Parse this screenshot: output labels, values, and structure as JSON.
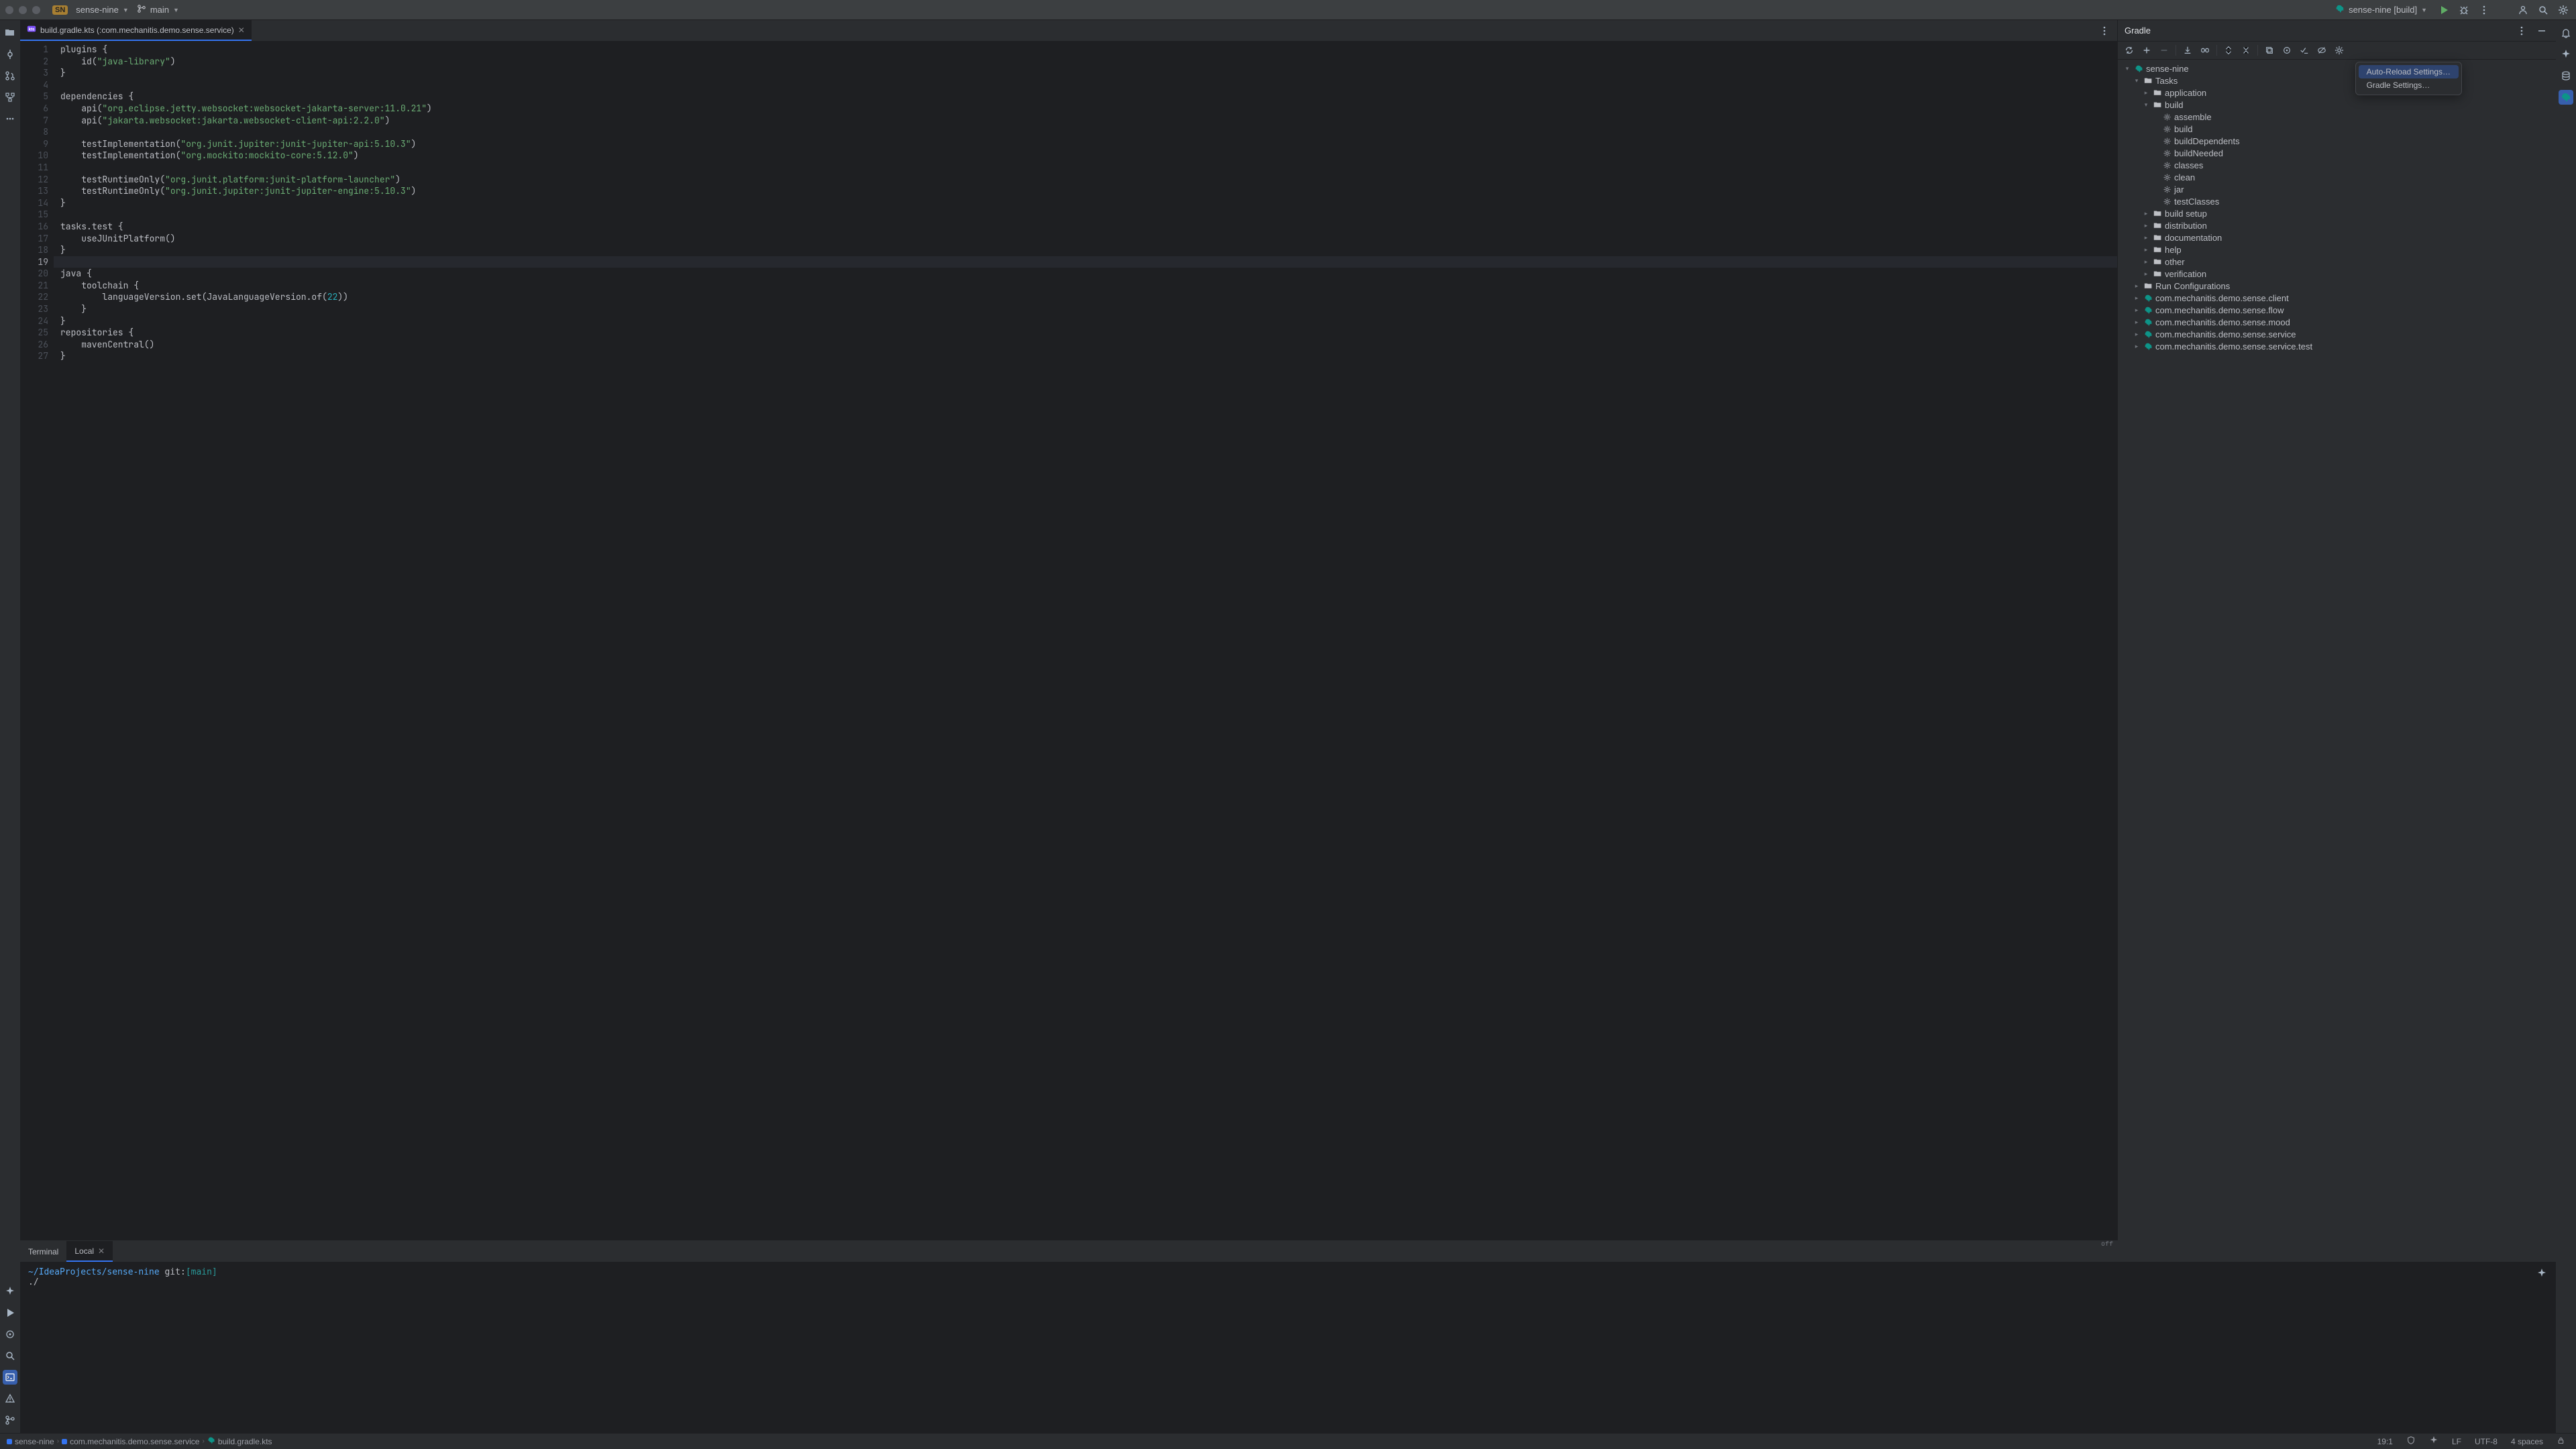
{
  "topbar": {
    "project_badge": "SN",
    "project_name": "sense-nine",
    "branch": "main",
    "run_config": "sense-nine [build]"
  },
  "editor": {
    "tab_label": "build.gradle.kts (:com.mechanitis.demo.sense.service)",
    "off_label": "off",
    "lines": [
      {
        "n": 1,
        "seg": [
          {
            "t": "plugins {",
            "c": ""
          }
        ]
      },
      {
        "n": 2,
        "seg": [
          {
            "t": "    id(",
            "c": ""
          },
          {
            "t": "\"java-library\"",
            "c": "str"
          },
          {
            "t": ")",
            "c": ""
          }
        ]
      },
      {
        "n": 3,
        "seg": [
          {
            "t": "}",
            "c": ""
          }
        ]
      },
      {
        "n": 4,
        "seg": [
          {
            "t": "",
            "c": ""
          }
        ]
      },
      {
        "n": 5,
        "seg": [
          {
            "t": "dependencies {",
            "c": ""
          }
        ]
      },
      {
        "n": 6,
        "seg": [
          {
            "t": "    api(",
            "c": ""
          },
          {
            "t": "\"org.eclipse.jetty.websocket:websocket-jakarta-server:11.0.21\"",
            "c": "str"
          },
          {
            "t": ")",
            "c": ""
          }
        ]
      },
      {
        "n": 7,
        "seg": [
          {
            "t": "    api(",
            "c": ""
          },
          {
            "t": "\"jakarta.websocket:jakarta.websocket-client-api:2.2.0\"",
            "c": "str"
          },
          {
            "t": ")",
            "c": ""
          }
        ]
      },
      {
        "n": 8,
        "seg": [
          {
            "t": "",
            "c": ""
          }
        ]
      },
      {
        "n": 9,
        "seg": [
          {
            "t": "    testImplementation(",
            "c": ""
          },
          {
            "t": "\"org.junit.jupiter:junit-jupiter-api:5.10.3\"",
            "c": "str"
          },
          {
            "t": ")",
            "c": ""
          }
        ]
      },
      {
        "n": 10,
        "seg": [
          {
            "t": "    testImplementation(",
            "c": ""
          },
          {
            "t": "\"org.mockito:mockito-core:5.12.0\"",
            "c": "str"
          },
          {
            "t": ")",
            "c": ""
          }
        ]
      },
      {
        "n": 11,
        "seg": [
          {
            "t": "",
            "c": ""
          }
        ]
      },
      {
        "n": 12,
        "seg": [
          {
            "t": "    testRuntimeOnly(",
            "c": ""
          },
          {
            "t": "\"org.junit.platform:junit-platform-launcher\"",
            "c": "str"
          },
          {
            "t": ")",
            "c": ""
          }
        ]
      },
      {
        "n": 13,
        "seg": [
          {
            "t": "    testRuntimeOnly(",
            "c": ""
          },
          {
            "t": "\"org.junit.jupiter:junit-jupiter-engine:5.10.3\"",
            "c": "str"
          },
          {
            "t": ")",
            "c": ""
          }
        ]
      },
      {
        "n": 14,
        "seg": [
          {
            "t": "}",
            "c": ""
          }
        ]
      },
      {
        "n": 15,
        "seg": [
          {
            "t": "",
            "c": ""
          }
        ]
      },
      {
        "n": 16,
        "seg": [
          {
            "t": "tasks.test {",
            "c": ""
          }
        ]
      },
      {
        "n": 17,
        "seg": [
          {
            "t": "    useJUnitPlatform()",
            "c": ""
          }
        ]
      },
      {
        "n": 18,
        "seg": [
          {
            "t": "}",
            "c": ""
          }
        ]
      },
      {
        "n": 19,
        "seg": [
          {
            "t": "",
            "c": ""
          }
        ],
        "current": true
      },
      {
        "n": 20,
        "seg": [
          {
            "t": "java {",
            "c": ""
          }
        ]
      },
      {
        "n": 21,
        "seg": [
          {
            "t": "    toolchain {",
            "c": ""
          }
        ]
      },
      {
        "n": 22,
        "seg": [
          {
            "t": "        languageVersion.set(JavaLanguageVersion.of(",
            "c": ""
          },
          {
            "t": "22",
            "c": "num"
          },
          {
            "t": "))",
            "c": ""
          }
        ]
      },
      {
        "n": 23,
        "seg": [
          {
            "t": "    }",
            "c": ""
          }
        ]
      },
      {
        "n": 24,
        "seg": [
          {
            "t": "}",
            "c": ""
          }
        ]
      },
      {
        "n": 25,
        "seg": [
          {
            "t": "repositories {",
            "c": ""
          }
        ]
      },
      {
        "n": 26,
        "seg": [
          {
            "t": "    mavenCentral()",
            "c": ""
          }
        ]
      },
      {
        "n": 27,
        "seg": [
          {
            "t": "}",
            "c": ""
          }
        ]
      }
    ]
  },
  "gradle": {
    "title": "Gradle",
    "popup": {
      "auto_reload": "Auto-Reload Settings…",
      "gradle_settings": "Gradle Settings…"
    },
    "tree": [
      {
        "depth": 0,
        "arrow": "open",
        "icon": "elephant",
        "label": "sense-nine"
      },
      {
        "depth": 1,
        "arrow": "open",
        "icon": "folder",
        "label": "Tasks"
      },
      {
        "depth": 2,
        "arrow": "closed",
        "icon": "folder",
        "label": "application"
      },
      {
        "depth": 2,
        "arrow": "open",
        "icon": "folder",
        "label": "build"
      },
      {
        "depth": 3,
        "arrow": "none",
        "icon": "gear",
        "label": "assemble"
      },
      {
        "depth": 3,
        "arrow": "none",
        "icon": "gear",
        "label": "build"
      },
      {
        "depth": 3,
        "arrow": "none",
        "icon": "gear",
        "label": "buildDependents"
      },
      {
        "depth": 3,
        "arrow": "none",
        "icon": "gear",
        "label": "buildNeeded"
      },
      {
        "depth": 3,
        "arrow": "none",
        "icon": "gear",
        "label": "classes"
      },
      {
        "depth": 3,
        "arrow": "none",
        "icon": "gear",
        "label": "clean"
      },
      {
        "depth": 3,
        "arrow": "none",
        "icon": "gear",
        "label": "jar"
      },
      {
        "depth": 3,
        "arrow": "none",
        "icon": "gear",
        "label": "testClasses"
      },
      {
        "depth": 2,
        "arrow": "closed",
        "icon": "folder",
        "label": "build setup"
      },
      {
        "depth": 2,
        "arrow": "closed",
        "icon": "folder",
        "label": "distribution"
      },
      {
        "depth": 2,
        "arrow": "closed",
        "icon": "folder",
        "label": "documentation"
      },
      {
        "depth": 2,
        "arrow": "closed",
        "icon": "folder",
        "label": "help"
      },
      {
        "depth": 2,
        "arrow": "closed",
        "icon": "folder",
        "label": "other"
      },
      {
        "depth": 2,
        "arrow": "closed",
        "icon": "folder",
        "label": "verification"
      },
      {
        "depth": 1,
        "arrow": "closed",
        "icon": "folder",
        "label": "Run Configurations"
      },
      {
        "depth": 1,
        "arrow": "closed",
        "icon": "elephant",
        "label": "com.mechanitis.demo.sense.client"
      },
      {
        "depth": 1,
        "arrow": "closed",
        "icon": "elephant",
        "label": "com.mechanitis.demo.sense.flow"
      },
      {
        "depth": 1,
        "arrow": "closed",
        "icon": "elephant",
        "label": "com.mechanitis.demo.sense.mood"
      },
      {
        "depth": 1,
        "arrow": "closed",
        "icon": "elephant",
        "label": "com.mechanitis.demo.sense.service"
      },
      {
        "depth": 1,
        "arrow": "closed",
        "icon": "elephant",
        "label": "com.mechanitis.demo.sense.service.test"
      }
    ]
  },
  "terminal": {
    "tab_primary": "Terminal",
    "tab_local": "Local",
    "lines": {
      "cwd": "~/IdeaProjects/sense-nine",
      "git_label": "git:",
      "branch": "[main]",
      "prompt": "./"
    }
  },
  "statusbar": {
    "crumb_project": "sense-nine",
    "crumb_module": "com.mechanitis.demo.sense.service",
    "crumb_file": "build.gradle.kts",
    "cursor": "19:1",
    "line_sep": "LF",
    "encoding": "UTF-8",
    "indent": "4 spaces"
  }
}
